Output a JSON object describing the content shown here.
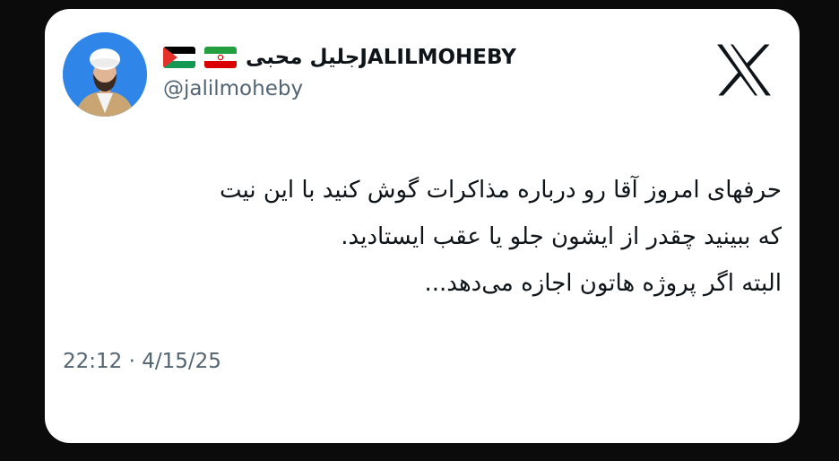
{
  "tweet": {
    "display_name": "جلیل محبیJALILMOHEBY",
    "handle": "@jalilmoheby",
    "flags": [
      "iran-flag",
      "palestine-flag"
    ],
    "text_lines": [
      "حرفهای امروز آقا رو درباره مذاکرات گوش کنید با این نیت",
      "که ببینید چقدر از ایشون جلو یا عقب ایستادید.",
      "البته اگر پروژه هاتون اجازه می‌دهد..."
    ],
    "time": "22:12",
    "separator": "·",
    "date": "4/15/25",
    "platform_icon": "x-logo-icon"
  },
  "colors": {
    "background": "#0b0b0b",
    "card": "#ffffff",
    "text": "#0f1419",
    "muted": "#536471",
    "avatar_bg": "#2f86e8"
  }
}
